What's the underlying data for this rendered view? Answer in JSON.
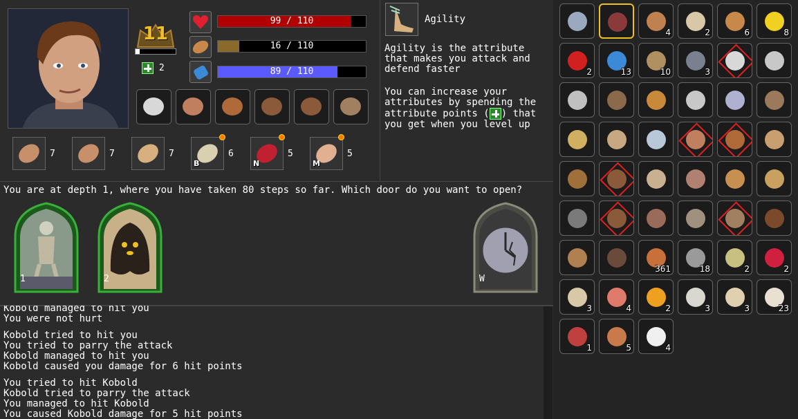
{
  "character": {
    "level": "11",
    "attribute_points": "2",
    "health": {
      "label": "99 / 110",
      "fraction": 0.9,
      "color": "#b00000"
    },
    "food": {
      "label": "16 / 110",
      "fraction": 0.145,
      "color": "#8a6a2a"
    },
    "mana": {
      "label": "89 / 110",
      "fraction": 0.81,
      "color": "#5a5aff"
    },
    "xp_fraction": 0.1
  },
  "equipment": [
    {
      "name": "scimitar-icon"
    },
    {
      "name": "amulet-icon"
    },
    {
      "name": "leather-helmet-icon"
    },
    {
      "name": "leather-armor-icon"
    },
    {
      "name": "leather-gloves-icon"
    },
    {
      "name": "leather-boots-icon"
    }
  ],
  "attributes": [
    {
      "name": "strength-icon",
      "value": "7",
      "key": ""
    },
    {
      "name": "dexterity-icon",
      "value": "7",
      "key": ""
    },
    {
      "name": "agility-icon",
      "value": "7",
      "key": ""
    },
    {
      "name": "bones-icon",
      "value": "6",
      "key": "B"
    },
    {
      "name": "heart-icon",
      "value": "5",
      "key": "N"
    },
    {
      "name": "eye-icon",
      "value": "5",
      "key": "M"
    }
  ],
  "info": {
    "title": "Agility",
    "para1": "Agility is the attribute\nthat makes you attack and\ndefend faster",
    "para2a": "You can increase your\nattributes by spending the\nattribute points (",
    "para2b": ") that",
    "para2c": "you get when you level up"
  },
  "prompt": "You are at depth 1, where you have taken 80 steps so far. Which door do you want to open?",
  "doors": [
    {
      "label": "1",
      "frame": "#2a8a2a"
    },
    {
      "label": "2",
      "frame": "#2a8a2a"
    },
    {
      "label": "W",
      "frame": "#7a7a6a"
    }
  ],
  "log": [
    [
      "Kobold managed to hit you",
      "You were not hurt"
    ],
    [
      "Kobold tried to hit you",
      "You tried to parry the attack",
      "Kobold managed to hit you",
      "Kobold caused you damage for 6 hit points"
    ],
    [
      "You tried to hit Kobold",
      "Kobold tried to parry the attack",
      "You managed to hit Kobold",
      "You caused Kobold damage for 5 hit points"
    ]
  ],
  "inventory": [
    {
      "name": "spellbook-icon",
      "count": "",
      "color": "#9aa8c0"
    },
    {
      "name": "journal-icon",
      "count": "",
      "color": "#8a3a3a"
    },
    {
      "name": "drumstick-icon",
      "count": "4",
      "color": "#c08050"
    },
    {
      "name": "egg-icon",
      "count": "2",
      "color": "#d8c8a8"
    },
    {
      "name": "bread-icon",
      "count": "6",
      "color": "#c8884a"
    },
    {
      "name": "banana-icon",
      "count": "8",
      "color": "#f0d020"
    },
    {
      "name": "apple-icon",
      "count": "2",
      "color": "#d02020"
    },
    {
      "name": "potion-icon",
      "count": "13",
      "color": "#3a8ad8"
    },
    {
      "name": "pouch-icon",
      "count": "10",
      "color": "#b09060"
    },
    {
      "name": "backpack-icon",
      "count": "3",
      "color": "#7a8090"
    },
    {
      "name": "scimitar-icon",
      "count": "",
      "color": "#d8d8d8"
    },
    {
      "name": "dagger-icon",
      "count": "",
      "color": "#c8c8c8"
    },
    {
      "name": "cleaver-icon",
      "count": "",
      "color": "#c0c0c0"
    },
    {
      "name": "pickaxe-icon",
      "count": "",
      "color": "#8a6a4a"
    },
    {
      "name": "torch-icon",
      "count": "",
      "color": "#c88a3a"
    },
    {
      "name": "knife-icon",
      "count": "",
      "color": "#c8c8c8"
    },
    {
      "name": "curved-blade-icon",
      "count": "",
      "color": "#b0b0d0"
    },
    {
      "name": "mattock-icon",
      "count": "",
      "color": "#9a7a5a"
    },
    {
      "name": "kris-icon",
      "count": "",
      "color": "#d0b060"
    },
    {
      "name": "hunting-knife-icon",
      "count": "",
      "color": "#c8a880"
    },
    {
      "name": "long-knife-icon",
      "count": "",
      "color": "#b8c8d8"
    },
    {
      "name": "amulet-icon",
      "count": "",
      "color": "#c08060"
    },
    {
      "name": "leather-helmet-icon",
      "count": "",
      "color": "#b06a3a"
    },
    {
      "name": "bronze-helmet-icon",
      "count": "",
      "color": "#c8a070"
    },
    {
      "name": "leather-hat-icon",
      "count": "",
      "color": "#a0703a"
    },
    {
      "name": "leather-armor-icon",
      "count": "",
      "color": "#8a5a3a"
    },
    {
      "name": "linen-shirt-icon",
      "count": "",
      "color": "#c8b090"
    },
    {
      "name": "tunic-icon",
      "count": "",
      "color": "#b08070"
    },
    {
      "name": "vest-icon",
      "count": "",
      "color": "#c89050"
    },
    {
      "name": "shirt-icon",
      "count": "",
      "color": "#c8a060"
    },
    {
      "name": "bracers-icon",
      "count": "",
      "color": "#7a7a7a"
    },
    {
      "name": "leather-gloves-icon",
      "count": "",
      "color": "#8a5a3a"
    },
    {
      "name": "trousers-icon",
      "count": "",
      "color": "#9a6a5a"
    },
    {
      "name": "cloth-pants-icon",
      "count": "",
      "color": "#a09080"
    },
    {
      "name": "leather-boots-icon",
      "count": "",
      "color": "#a08060"
    },
    {
      "name": "brown-boots-icon",
      "count": "",
      "color": "#7a4a2a"
    },
    {
      "name": "tall-boots-icon",
      "count": "",
      "color": "#b08050"
    },
    {
      "name": "work-boots-icon",
      "count": "",
      "color": "#6a4a3a"
    },
    {
      "name": "coin-icon",
      "count": "361",
      "color": "#c8703a"
    },
    {
      "name": "stone-icon",
      "count": "18",
      "color": "#9a9a9a"
    },
    {
      "name": "cube-icon",
      "count": "2",
      "color": "#c8c080"
    },
    {
      "name": "heart-organ-icon",
      "count": "2",
      "color": "#d02040"
    },
    {
      "name": "skull-icon",
      "count": "3",
      "color": "#d8c8a8"
    },
    {
      "name": "eyeball-icon",
      "count": "4",
      "color": "#e07a6a"
    },
    {
      "name": "dragon-eye-icon",
      "count": "2",
      "color": "#f0a020"
    },
    {
      "name": "spine-icon",
      "count": "3",
      "color": "#d8d8d0"
    },
    {
      "name": "fang-icon",
      "count": "3",
      "color": "#e0d0b0"
    },
    {
      "name": "bone-icon",
      "count": "23",
      "color": "#e8e0d0"
    },
    {
      "name": "worm-icon",
      "count": "1",
      "color": "#c04040"
    },
    {
      "name": "mushroom-icon",
      "count": "5",
      "color": "#c87a4a"
    },
    {
      "name": "daisy-icon",
      "count": "4",
      "color": "#f0f0f0"
    }
  ]
}
